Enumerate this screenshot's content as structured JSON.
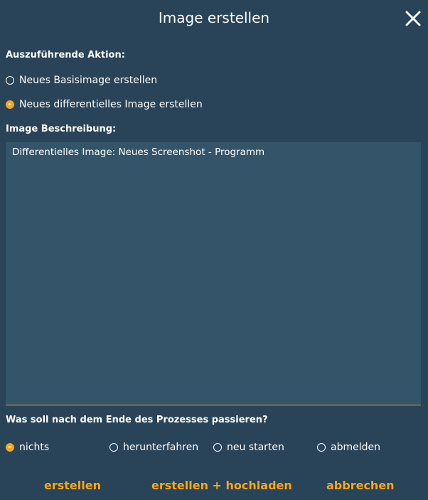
{
  "dialog": {
    "title": "Image erstellen"
  },
  "action": {
    "label": "Auszuführende Aktion:",
    "options": [
      {
        "label": "Neues Basisimage erstellen",
        "checked": false
      },
      {
        "label": "Neues differentielles Image erstellen",
        "checked": true
      }
    ]
  },
  "description": {
    "label": "Image Beschreibung:",
    "value": "Differentielles Image: Neues Screenshot - Programm"
  },
  "after_process": {
    "label": "Was soll nach dem Ende des Prozesses passieren?",
    "options": [
      {
        "label": "nichts",
        "checked": true
      },
      {
        "label": "herunterfahren",
        "checked": false
      },
      {
        "label": "neu starten",
        "checked": false
      },
      {
        "label": "abmelden",
        "checked": false
      }
    ]
  },
  "buttons": {
    "create": "erstellen",
    "create_upload": "erstellen + hochladen",
    "cancel": "abbrechen"
  },
  "colors": {
    "background": "#294358",
    "textarea": "#345469",
    "accent": "#f4a81d"
  },
  "icons": {
    "close": "close-icon"
  }
}
